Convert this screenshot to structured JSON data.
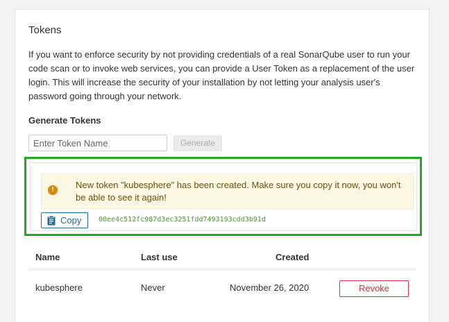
{
  "section": {
    "title": "Tokens",
    "description": "If you want to enforce security by not providing credentials of a real SonarQube user to run your code scan or to invoke web services, you can provide a User Token as a replacement of the user login. This will increase the security of your installation by not letting your analysis user's password going through your network."
  },
  "generate": {
    "title": "Generate Tokens",
    "input_placeholder": "Enter Token Name",
    "input_value": "",
    "button_label": "Generate"
  },
  "new_token": {
    "alert_text": "New token \"kubesphere\" has been created. Make sure you copy it now, you won't be able to see it again!",
    "alert_icon": "warning-circle-icon",
    "copy_label": "Copy",
    "copy_icon": "clipboard-icon",
    "token": "00ee4c512fc987d3ec3251fdd7493193cdd3b91d"
  },
  "table": {
    "headers": {
      "name": "Name",
      "last_use": "Last use",
      "created": "Created"
    },
    "rows": [
      {
        "name": "kubesphere",
        "last_use": "Never",
        "created": "November 26, 2020",
        "action": "Revoke"
      }
    ]
  },
  "colors": {
    "highlight_border": "#22a822",
    "alert_bg": "#fcf8e3",
    "primary": "#236a97",
    "danger": "#d4333f",
    "token_text": "#4c9b2c"
  }
}
